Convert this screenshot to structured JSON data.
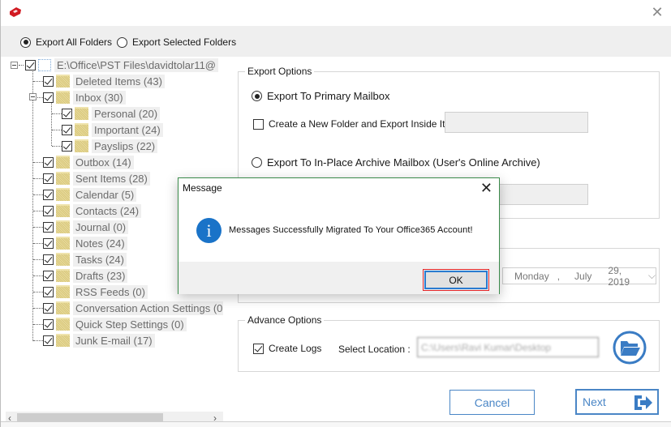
{
  "window": {
    "close_label": "✕"
  },
  "export_scope": {
    "options": [
      {
        "label": "Export All Folders",
        "selected": true
      },
      {
        "label": "Export Selected Folders",
        "selected": false
      }
    ]
  },
  "tree": {
    "root": {
      "label": "E:\\Office\\PST Files\\davidtolar11@",
      "checked": true,
      "expanded": true
    },
    "items": [
      {
        "label": "Deleted Items (43)",
        "level": 1,
        "checked": true
      },
      {
        "label": "Inbox (30)",
        "level": 1,
        "checked": true,
        "expanded": true
      },
      {
        "label": "Personal (20)",
        "level": 2,
        "checked": true
      },
      {
        "label": "Important (24)",
        "level": 2,
        "checked": true
      },
      {
        "label": "Payslips (22)",
        "level": 2,
        "checked": true
      },
      {
        "label": "Outbox (14)",
        "level": 1,
        "checked": true
      },
      {
        "label": "Sent Items (28)",
        "level": 1,
        "checked": true
      },
      {
        "label": "Calendar (5)",
        "level": 1,
        "checked": true
      },
      {
        "label": "Contacts (24)",
        "level": 1,
        "checked": true
      },
      {
        "label": "Journal (0)",
        "level": 1,
        "checked": true
      },
      {
        "label": "Notes (24)",
        "level": 1,
        "checked": true
      },
      {
        "label": "Tasks (24)",
        "level": 1,
        "checked": true
      },
      {
        "label": "Drafts (23)",
        "level": 1,
        "checked": true
      },
      {
        "label": "RSS Feeds (0)",
        "level": 1,
        "checked": true
      },
      {
        "label": "Conversation Action Settings (0",
        "level": 1,
        "checked": true
      },
      {
        "label": "Quick Step Settings (0)",
        "level": 1,
        "checked": true
      },
      {
        "label": "Junk E-mail (17)",
        "level": 1,
        "checked": true
      }
    ],
    "scroll_left": "‹",
    "scroll_right": "›"
  },
  "export_options": {
    "title": "Export Options",
    "primary_label": "Export To Primary Mailbox",
    "primary_selected": true,
    "new_folder_label": "Create a New Folder and Export Inside It.",
    "new_folder_checked": false,
    "new_folder_value": "",
    "archive_label": "Export To In-Place Archive Mailbox (User's Online Archive)",
    "archive_selected": false,
    "archive_folder_value": ""
  },
  "date_filter": {
    "day": "Monday",
    "sep": ",",
    "month": "July",
    "date_year": "29, 2019",
    "chevron": "⌵"
  },
  "advance_options": {
    "title": "Advance Options",
    "create_logs_label": "Create Logs",
    "create_logs_checked": true,
    "select_location_label": "Select Location :",
    "location_value": "C:\\Users\\Ravi Kumar\\Desktop"
  },
  "footer": {
    "cancel_label": "Cancel",
    "next_label": "Next"
  },
  "dialog": {
    "title": "Message",
    "close_label": "✕",
    "message": "Messages Successfully Migrated To Your Office365 Account!",
    "icon_glyph": "i",
    "ok_label": "OK"
  },
  "colors": {
    "accent": "#4a86c6",
    "info_blue": "#1a73c8",
    "dialog_border": "#3a8a4a",
    "focus_red": "#e0262a"
  }
}
